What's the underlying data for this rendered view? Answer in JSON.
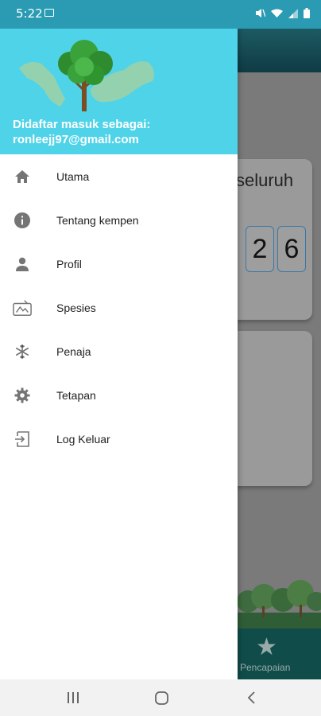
{
  "status_bar": {
    "time": "5:22"
  },
  "drawer": {
    "signed_in_label": "Didaftar masuk sebagai:",
    "email": "ronleejj97@gmail.com",
    "items": [
      {
        "label": "Utama",
        "icon": "home-icon"
      },
      {
        "label": "Tentang kempen",
        "icon": "info-icon"
      },
      {
        "label": "Profil",
        "icon": "person-icon"
      },
      {
        "label": "Spesies",
        "icon": "species-icon"
      },
      {
        "label": "Penaja",
        "icon": "snowflake-icon"
      },
      {
        "label": "Tetapan",
        "icon": "gear-icon"
      },
      {
        "label": "Log Keluar",
        "icon": "logout-icon"
      }
    ]
  },
  "background_app": {
    "card_text": "seluruh",
    "digits": [
      "2",
      "6"
    ],
    "bottom_nav_label": "Pencapaian"
  },
  "colors": {
    "status_bar": "#2a9bb3",
    "drawer_header": "#4fd3e9",
    "icon_grey": "#757575"
  }
}
